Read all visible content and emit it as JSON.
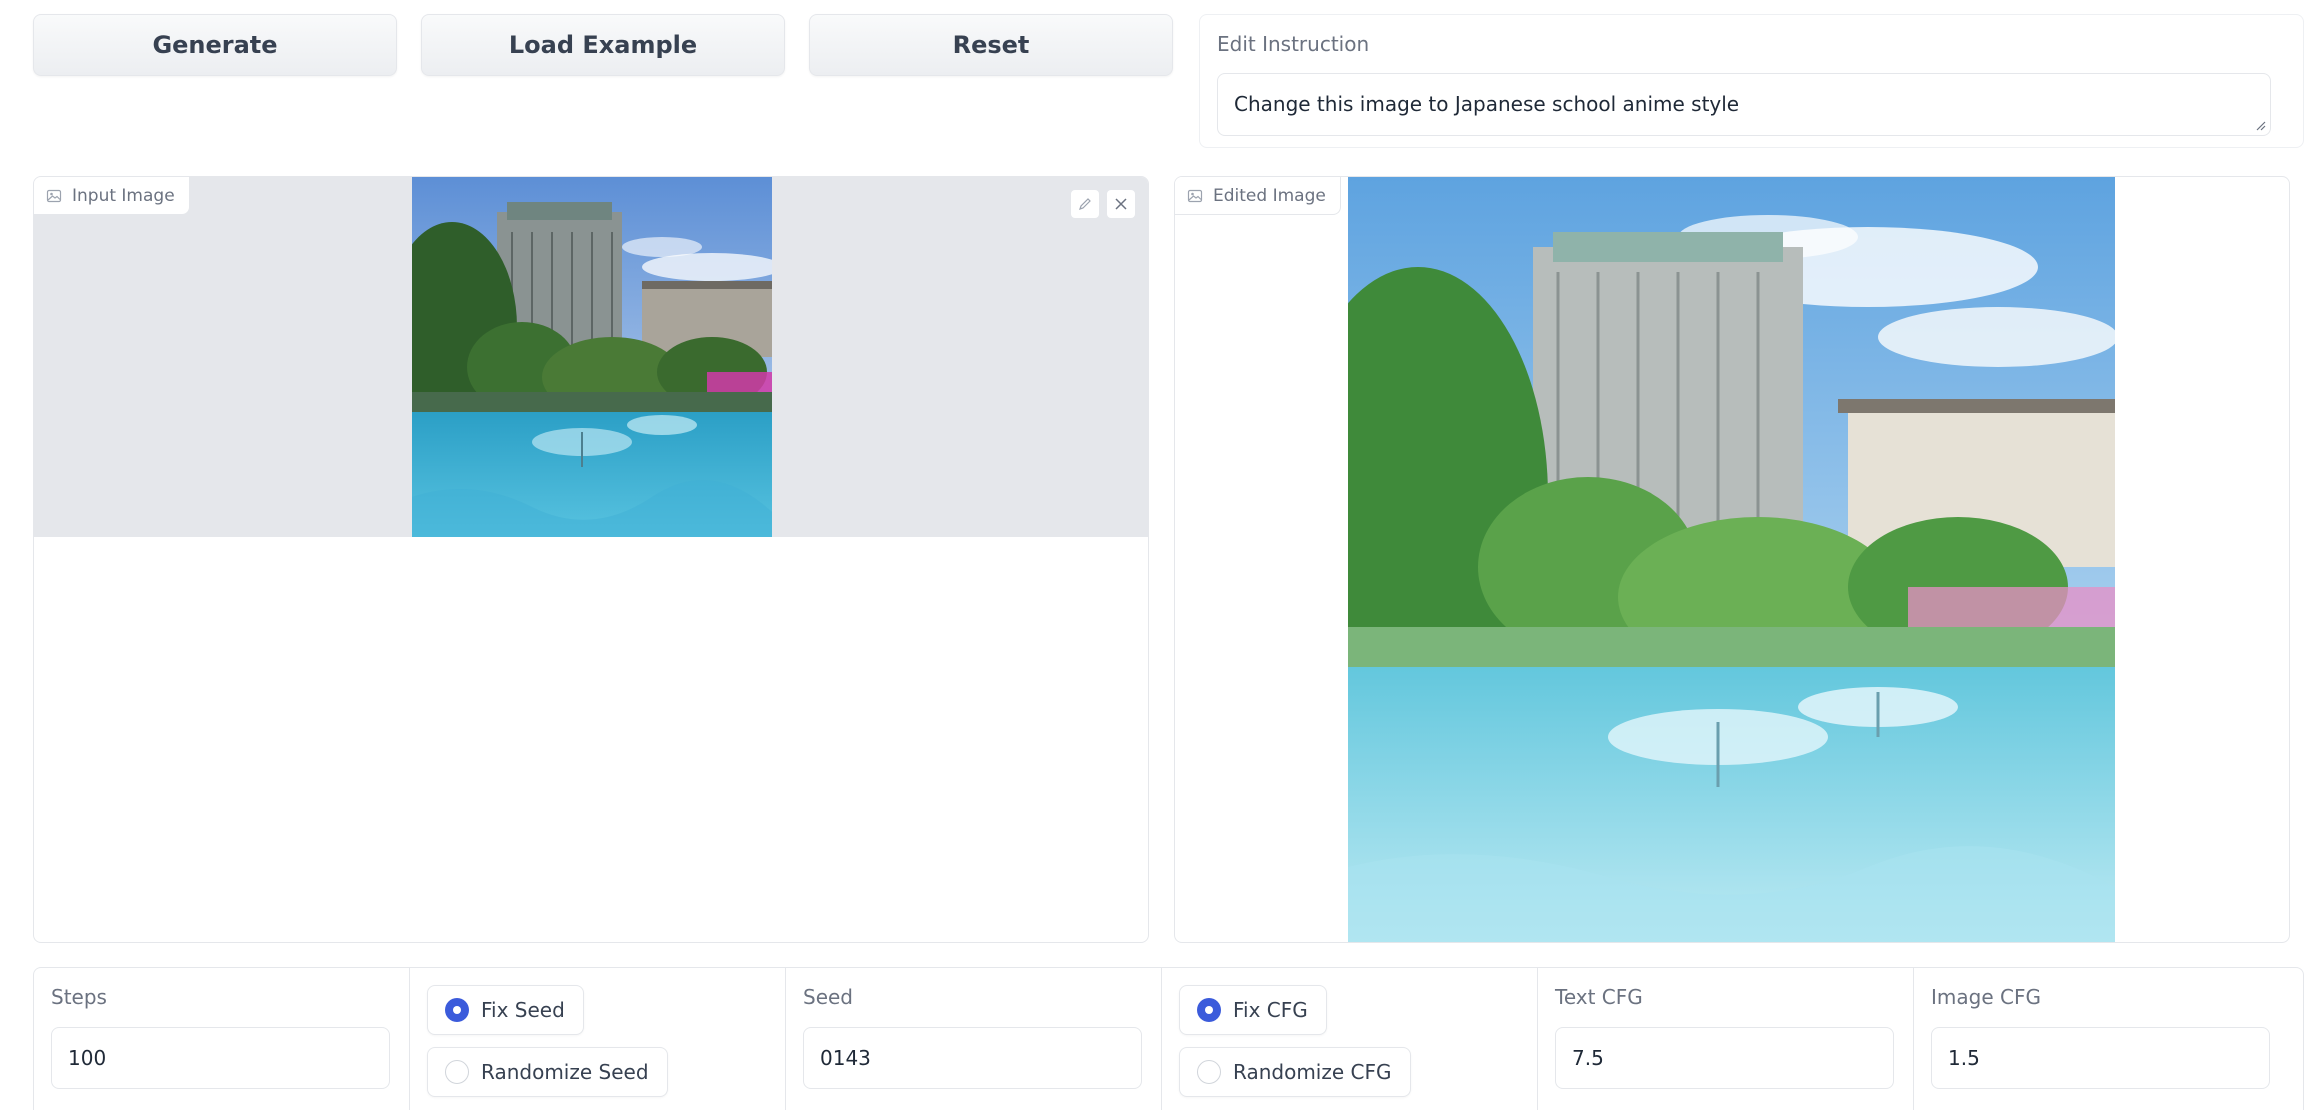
{
  "toolbar": {
    "generate_label": "Generate",
    "load_example_label": "Load Example",
    "reset_label": "Reset"
  },
  "edit_instruction": {
    "label": "Edit Instruction",
    "value": "Change this image to Japanese school anime style"
  },
  "input_image": {
    "label": "Input Image",
    "edit_icon": "pencil-icon",
    "clear_icon": "close-icon"
  },
  "edited_image": {
    "label": "Edited Image"
  },
  "controls": {
    "steps": {
      "label": "Steps",
      "value": "100"
    },
    "seed_mode": {
      "options": [
        "Fix Seed",
        "Randomize Seed"
      ],
      "selected": "Fix Seed"
    },
    "seed": {
      "label": "Seed",
      "value": "0143"
    },
    "cfg_mode": {
      "options": [
        "Fix CFG",
        "Randomize CFG"
      ],
      "selected": "Fix CFG"
    },
    "text_cfg": {
      "label": "Text CFG",
      "value": "7.5"
    },
    "image_cfg": {
      "label": "Image CFG",
      "value": "1.5"
    }
  },
  "colors": {
    "accent": "#3b5bdb",
    "border": "#e5e7eb",
    "label": "#6b7280"
  }
}
